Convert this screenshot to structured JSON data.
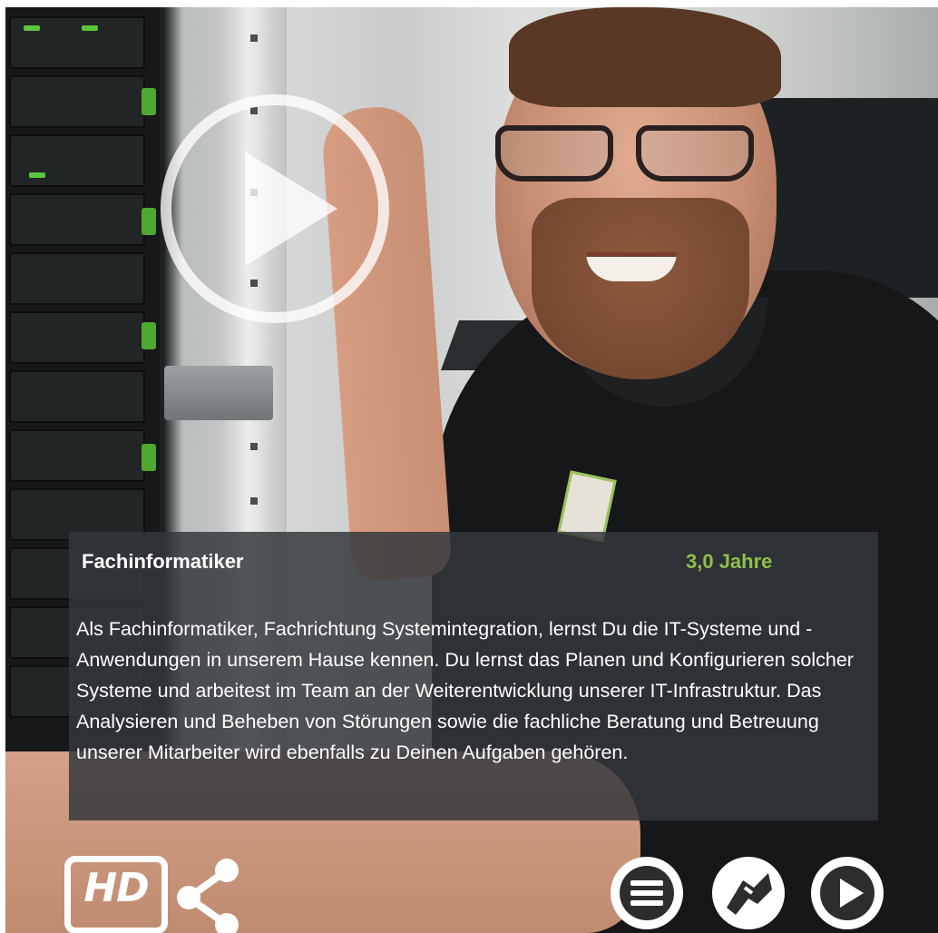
{
  "video": {
    "title": "Fachinformatiker",
    "duration": "3,0 Jahre",
    "description": "Als Fachinformatiker, Fachrichtung Systemintegration, lernst Du die IT-Systeme und -Anwendungen in unserem Hause kennen. Du lernst das Planen und Konfigurieren solcher Systeme und arbeitest im Team an der Weiterentwicklung unserer IT-Infrastruktur. Das Analysieren und Beheben von Störungen sowie die fachliche Beratung und Betreuung unserer Mitarbeiter wird ebenfalls zu Deinen Aufgaben gehören."
  },
  "controls": {
    "hd_label": "HD",
    "icons": {
      "big_play": "play-circle-icon",
      "share": "share-icon",
      "menu": "menu-icon",
      "stethoscope": "stethoscope-icon",
      "play": "play-icon"
    }
  },
  "colors": {
    "accent_green": "#8fc04a",
    "overlay": "#33373c",
    "text": "#ffffff"
  }
}
